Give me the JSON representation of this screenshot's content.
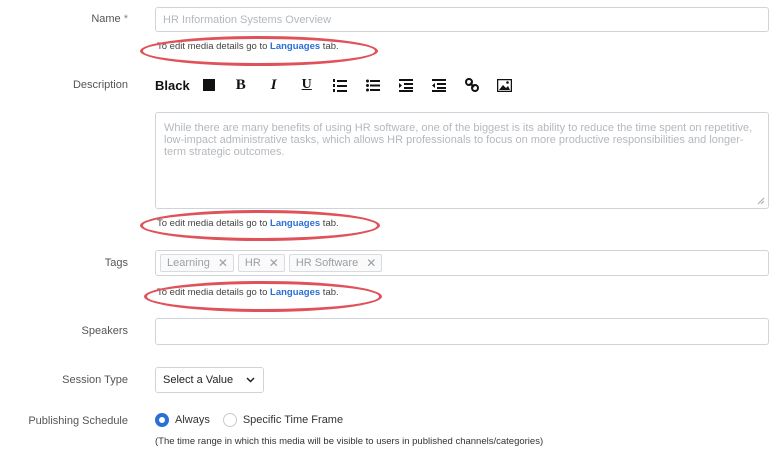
{
  "name_field": {
    "label": "Name",
    "required_mark": "*",
    "placeholder": "HR Information Systems Overview"
  },
  "hint": {
    "prefix": "To edit media details go to ",
    "link": "Languages",
    "suffix": " tab."
  },
  "description": {
    "label": "Description",
    "toolbar": {
      "color_label": "Black",
      "bold": "B",
      "italic": "I",
      "underline": "U"
    },
    "placeholder": "While there are many benefits of using HR software, one of the biggest is its ability to reduce the time spent on repetitive, low-impact administrative tasks, which allows HR professionals to focus on more productive responsibilities and longer-term strategic outcomes."
  },
  "tags": {
    "label": "Tags",
    "items": [
      "Learning",
      "HR",
      "HR Software"
    ],
    "remove_glyph": "✕"
  },
  "speakers": {
    "label": "Speakers",
    "value": ""
  },
  "session_type": {
    "label": "Session Type",
    "selected": "Select a Value"
  },
  "publishing": {
    "label": "Publishing Schedule",
    "options": [
      "Always",
      "Specific Time Frame"
    ],
    "selected": "Always",
    "note": "(The time range in which this media will be visible to users in published channels/categories)"
  },
  "colors": {
    "accent": "#2a6fd6",
    "annotation": "#e05259",
    "border": "#cfd4da"
  }
}
